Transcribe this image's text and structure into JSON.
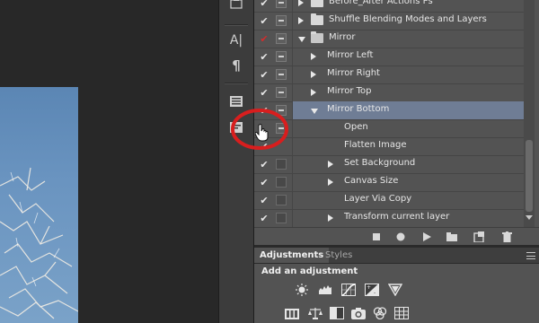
{
  "actions_panel": {
    "rows": [
      {
        "label": "Before_After Actions Ps",
        "check": "✔",
        "red": false,
        "dialog": "filled",
        "kind": "set",
        "open": false,
        "indent": 0,
        "selected": false
      },
      {
        "label": "Shuffle Blending Modes and Layers",
        "check": "✔",
        "red": false,
        "dialog": "filled",
        "kind": "set",
        "open": false,
        "indent": 0,
        "selected": false
      },
      {
        "label": "Mirror",
        "check": "✔",
        "red": true,
        "dialog": "filled",
        "kind": "set",
        "open": true,
        "indent": 0,
        "selected": false
      },
      {
        "label": "Mirror Left",
        "check": "✔",
        "red": false,
        "dialog": "filled",
        "kind": "action",
        "open": false,
        "indent": 1,
        "selected": false
      },
      {
        "label": "Mirror Right",
        "check": "✔",
        "red": false,
        "dialog": "filled",
        "kind": "action",
        "open": false,
        "indent": 1,
        "selected": false
      },
      {
        "label": "Mirror Top",
        "check": "✔",
        "red": false,
        "dialog": "filled",
        "kind": "action",
        "open": false,
        "indent": 1,
        "selected": false
      },
      {
        "label": "Mirror Bottom",
        "check": "✔",
        "red": false,
        "dialog": "filled",
        "kind": "action",
        "open": true,
        "indent": 1,
        "selected": true
      },
      {
        "label": "Open",
        "check": "",
        "red": false,
        "dialog": "filled",
        "kind": "step",
        "open": false,
        "indent": 2,
        "selected": false
      },
      {
        "label": "Flatten Image",
        "check": "✔",
        "red": false,
        "dialog": "none",
        "kind": "step",
        "open": false,
        "indent": 2,
        "selected": false
      },
      {
        "label": "Set Background",
        "check": "✔",
        "red": false,
        "dialog": "empty",
        "kind": "step-expand",
        "open": false,
        "indent": 2,
        "selected": false
      },
      {
        "label": "Canvas Size",
        "check": "✔",
        "red": false,
        "dialog": "empty",
        "kind": "step-expand",
        "open": false,
        "indent": 2,
        "selected": false
      },
      {
        "label": "Layer Via Copy",
        "check": "✔",
        "red": false,
        "dialog": "empty",
        "kind": "step",
        "open": false,
        "indent": 2,
        "selected": false
      },
      {
        "label": "Transform current layer",
        "check": "✔",
        "red": false,
        "dialog": "empty",
        "kind": "step-expand",
        "open": false,
        "indent": 2,
        "selected": false
      }
    ],
    "toolbar_icons": [
      "stop-icon",
      "record-icon",
      "play-icon",
      "new-set-icon",
      "new-action-icon",
      "delete-icon"
    ]
  },
  "adjustments_panel": {
    "tab_active": "Adjustments",
    "tab_inactive": "Styles",
    "title": "Add an adjustment"
  },
  "toolstrip": {
    "text_icon": "A|",
    "paragraph_icon": "¶"
  },
  "colors": {
    "selected_row": "#6f7d95",
    "annotation_red": "#d81e1e",
    "panel_bg": "#535353"
  }
}
